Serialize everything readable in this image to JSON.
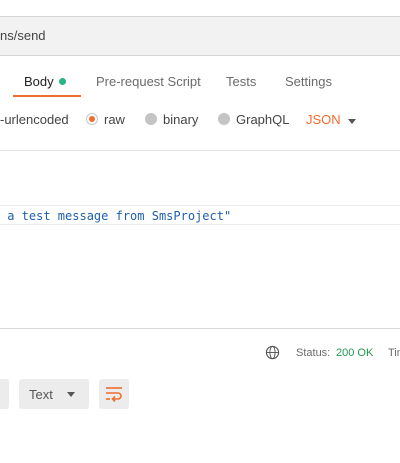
{
  "url_bar": {
    "path_fragment": "ns/send"
  },
  "tabs": {
    "body": "Body",
    "pre_request": "Pre-request Script",
    "tests": "Tests",
    "settings": "Settings"
  },
  "body_options": {
    "urlencoded": "-urlencoded",
    "raw": "raw",
    "binary": "binary",
    "graphql": "GraphQL",
    "format": "JSON",
    "selected": "raw"
  },
  "editor": {
    "line_fragment": " a test message from SmsProject\""
  },
  "response": {
    "status_label": "Status:",
    "status_value": "200 OK",
    "time_label": "Tim",
    "format": "Text"
  },
  "colors": {
    "accent": "#f06d2e",
    "success": "#26b47f",
    "code": "#1f5faa"
  }
}
